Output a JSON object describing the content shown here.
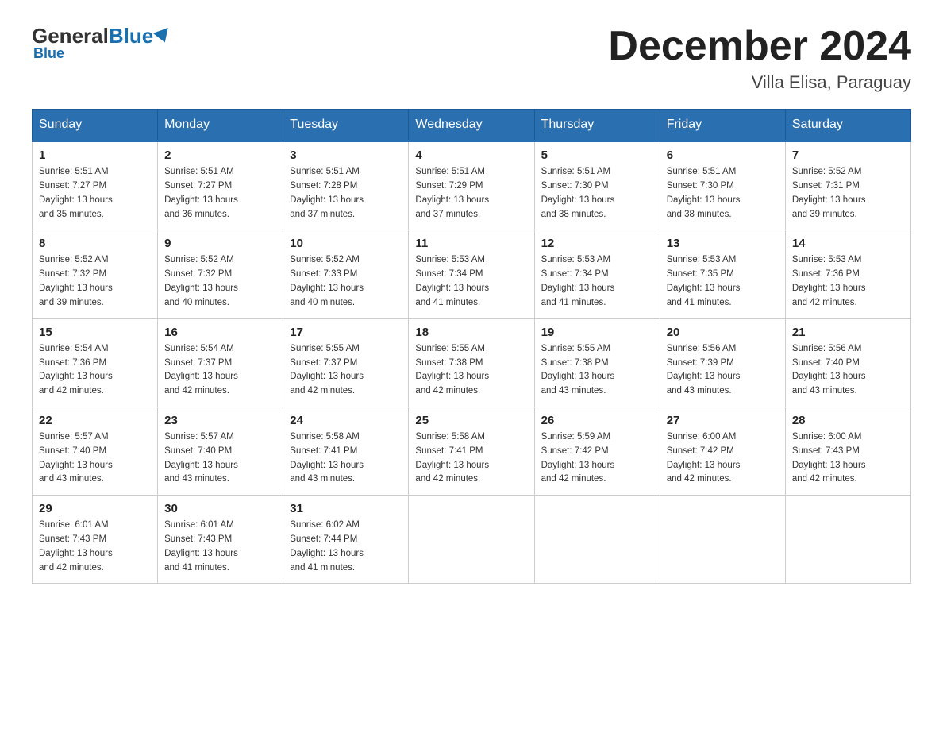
{
  "header": {
    "logo_general": "General",
    "logo_blue": "Blue",
    "month_title": "December 2024",
    "location": "Villa Elisa, Paraguay"
  },
  "days_of_week": [
    "Sunday",
    "Monday",
    "Tuesday",
    "Wednesday",
    "Thursday",
    "Friday",
    "Saturday"
  ],
  "weeks": [
    [
      {
        "day": "1",
        "sunrise": "5:51 AM",
        "sunset": "7:27 PM",
        "daylight": "13 hours and 35 minutes."
      },
      {
        "day": "2",
        "sunrise": "5:51 AM",
        "sunset": "7:27 PM",
        "daylight": "13 hours and 36 minutes."
      },
      {
        "day": "3",
        "sunrise": "5:51 AM",
        "sunset": "7:28 PM",
        "daylight": "13 hours and 37 minutes."
      },
      {
        "day": "4",
        "sunrise": "5:51 AM",
        "sunset": "7:29 PM",
        "daylight": "13 hours and 37 minutes."
      },
      {
        "day": "5",
        "sunrise": "5:51 AM",
        "sunset": "7:30 PM",
        "daylight": "13 hours and 38 minutes."
      },
      {
        "day": "6",
        "sunrise": "5:51 AM",
        "sunset": "7:30 PM",
        "daylight": "13 hours and 38 minutes."
      },
      {
        "day": "7",
        "sunrise": "5:52 AM",
        "sunset": "7:31 PM",
        "daylight": "13 hours and 39 minutes."
      }
    ],
    [
      {
        "day": "8",
        "sunrise": "5:52 AM",
        "sunset": "7:32 PM",
        "daylight": "13 hours and 39 minutes."
      },
      {
        "day": "9",
        "sunrise": "5:52 AM",
        "sunset": "7:32 PM",
        "daylight": "13 hours and 40 minutes."
      },
      {
        "day": "10",
        "sunrise": "5:52 AM",
        "sunset": "7:33 PM",
        "daylight": "13 hours and 40 minutes."
      },
      {
        "day": "11",
        "sunrise": "5:53 AM",
        "sunset": "7:34 PM",
        "daylight": "13 hours and 41 minutes."
      },
      {
        "day": "12",
        "sunrise": "5:53 AM",
        "sunset": "7:34 PM",
        "daylight": "13 hours and 41 minutes."
      },
      {
        "day": "13",
        "sunrise": "5:53 AM",
        "sunset": "7:35 PM",
        "daylight": "13 hours and 41 minutes."
      },
      {
        "day": "14",
        "sunrise": "5:53 AM",
        "sunset": "7:36 PM",
        "daylight": "13 hours and 42 minutes."
      }
    ],
    [
      {
        "day": "15",
        "sunrise": "5:54 AM",
        "sunset": "7:36 PM",
        "daylight": "13 hours and 42 minutes."
      },
      {
        "day": "16",
        "sunrise": "5:54 AM",
        "sunset": "7:37 PM",
        "daylight": "13 hours and 42 minutes."
      },
      {
        "day": "17",
        "sunrise": "5:55 AM",
        "sunset": "7:37 PM",
        "daylight": "13 hours and 42 minutes."
      },
      {
        "day": "18",
        "sunrise": "5:55 AM",
        "sunset": "7:38 PM",
        "daylight": "13 hours and 42 minutes."
      },
      {
        "day": "19",
        "sunrise": "5:55 AM",
        "sunset": "7:38 PM",
        "daylight": "13 hours and 43 minutes."
      },
      {
        "day": "20",
        "sunrise": "5:56 AM",
        "sunset": "7:39 PM",
        "daylight": "13 hours and 43 minutes."
      },
      {
        "day": "21",
        "sunrise": "5:56 AM",
        "sunset": "7:40 PM",
        "daylight": "13 hours and 43 minutes."
      }
    ],
    [
      {
        "day": "22",
        "sunrise": "5:57 AM",
        "sunset": "7:40 PM",
        "daylight": "13 hours and 43 minutes."
      },
      {
        "day": "23",
        "sunrise": "5:57 AM",
        "sunset": "7:40 PM",
        "daylight": "13 hours and 43 minutes."
      },
      {
        "day": "24",
        "sunrise": "5:58 AM",
        "sunset": "7:41 PM",
        "daylight": "13 hours and 43 minutes."
      },
      {
        "day": "25",
        "sunrise": "5:58 AM",
        "sunset": "7:41 PM",
        "daylight": "13 hours and 42 minutes."
      },
      {
        "day": "26",
        "sunrise": "5:59 AM",
        "sunset": "7:42 PM",
        "daylight": "13 hours and 42 minutes."
      },
      {
        "day": "27",
        "sunrise": "6:00 AM",
        "sunset": "7:42 PM",
        "daylight": "13 hours and 42 minutes."
      },
      {
        "day": "28",
        "sunrise": "6:00 AM",
        "sunset": "7:43 PM",
        "daylight": "13 hours and 42 minutes."
      }
    ],
    [
      {
        "day": "29",
        "sunrise": "6:01 AM",
        "sunset": "7:43 PM",
        "daylight": "13 hours and 42 minutes."
      },
      {
        "day": "30",
        "sunrise": "6:01 AM",
        "sunset": "7:43 PM",
        "daylight": "13 hours and 41 minutes."
      },
      {
        "day": "31",
        "sunrise": "6:02 AM",
        "sunset": "7:44 PM",
        "daylight": "13 hours and 41 minutes."
      },
      null,
      null,
      null,
      null
    ]
  ],
  "labels": {
    "sunrise": "Sunrise:",
    "sunset": "Sunset:",
    "daylight": "Daylight:"
  }
}
